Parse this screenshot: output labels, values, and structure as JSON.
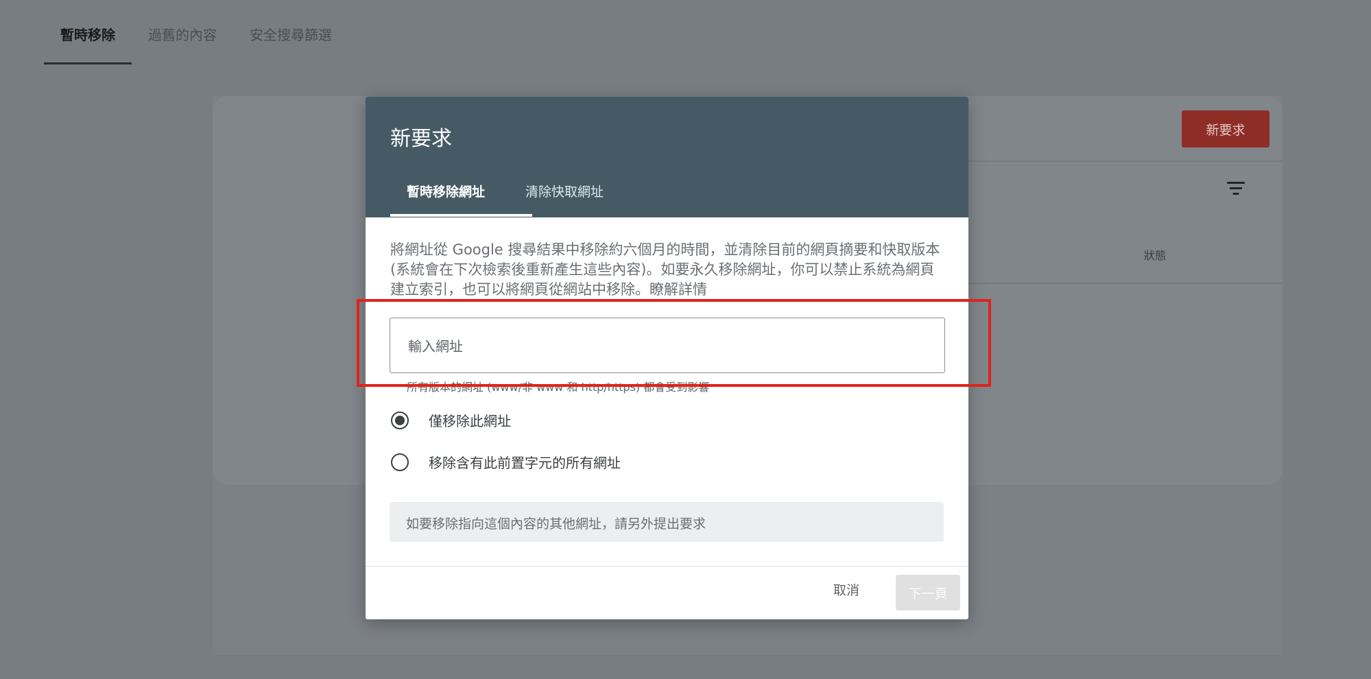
{
  "top_tabs": [
    {
      "label": "暫時移除"
    },
    {
      "label": "過舊的內容"
    },
    {
      "label": "安全搜尋篩選"
    }
  ],
  "background": {
    "new_request_label": "新要求",
    "status_header": "狀態"
  },
  "dialog": {
    "title": "新要求",
    "tabs": [
      {
        "label": "暫時移除網址"
      },
      {
        "label": "清除快取網址"
      }
    ],
    "description": "將網址從 Google 搜尋結果中移除約六個月的時間，並清除目前的網頁摘要和快取版本 (系統會在下次檢索後重新產生這些內容)。如要永久移除網址，你可以禁止系統為網頁建立索引，也可以將網頁從網站中移除。",
    "learn_more": "瞭解詳情",
    "url_input": {
      "placeholder": "輸入網址",
      "value": ""
    },
    "helper": "所有版本的網址 (www/非 www 和 http/https) 都會受到影響",
    "options": [
      {
        "label": "僅移除此網址",
        "checked": true
      },
      {
        "label": "移除含有此前置字元的所有網址",
        "checked": false
      }
    ],
    "info": "如要移除指向這個內容的其他網址，請另外提出要求",
    "cancel_label": "取消",
    "next_label": "下一頁"
  },
  "colors": {
    "scrim": "#787d82",
    "dialog_header": "#455a64",
    "highlight": "#e0211d",
    "new_button": "#8e2d26"
  },
  "icons": {
    "filter": "filter-icon"
  }
}
